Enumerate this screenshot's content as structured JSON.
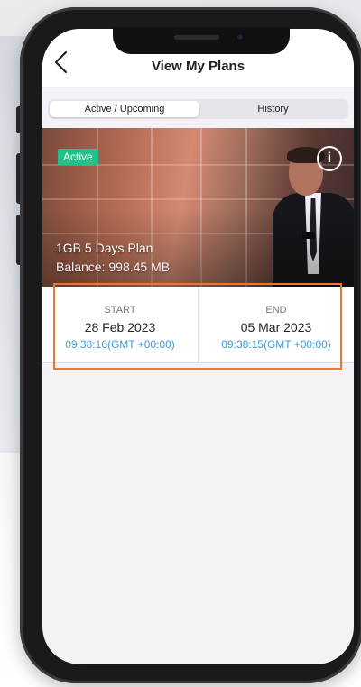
{
  "nav": {
    "title": "View My Plans",
    "back_icon": "chevron-left-icon"
  },
  "tabs": [
    {
      "label": "Active / Upcoming",
      "selected": true
    },
    {
      "label": "History",
      "selected": false
    }
  ],
  "plan": {
    "status": "Active",
    "status_color": "#23c28a",
    "info_icon": "info-icon",
    "info_glyph": "i",
    "name": "1GB 5 Days Plan",
    "balance": "Balance: 998.45 MB"
  },
  "dates": {
    "start_label": "START",
    "start_date": "28 Feb 2023",
    "start_time": "09:38:16(GMT +00:00)",
    "end_label": "END",
    "end_date": "05 Mar 2023",
    "end_time": "09:38:15(GMT +00:00)"
  },
  "colors": {
    "accent_time": "#3a9bd8",
    "highlight_border": "#e8773a"
  }
}
